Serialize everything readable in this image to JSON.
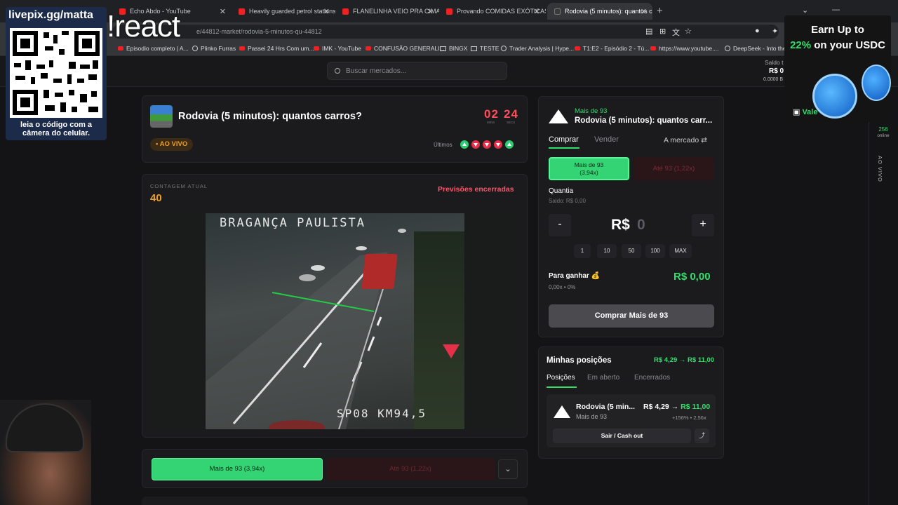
{
  "browser": {
    "tabs": [
      {
        "label": "Echo Abdo - YouTube",
        "active": false
      },
      {
        "label": "Heavily guarded petrol stations",
        "active": false
      },
      {
        "label": "FLANELINHA VEIO PRA CIMA, D",
        "active": false
      },
      {
        "label": "Provando COMIDAS EXÓTICAS",
        "active": false
      },
      {
        "label": "Rodovia (5 minutos): quantos c",
        "active": true
      }
    ],
    "url": "e/44812-market/rodovia-5-minutos-qu-44812",
    "bookmarks": [
      {
        "label": "Episodio completo | A...",
        "icon": "youtube-icon"
      },
      {
        "label": "Plinko Furras",
        "icon": "globe-icon"
      },
      {
        "label": "Passei 24 Hrs Com um...",
        "icon": "youtube-icon"
      },
      {
        "label": "IMK - YouTube",
        "icon": "youtube-icon"
      },
      {
        "label": "CONFUSÃO GENERALI...",
        "icon": "youtube-icon"
      },
      {
        "label": "BINGX",
        "icon": "folder-icon"
      },
      {
        "label": "TESTE",
        "icon": "folder-icon"
      },
      {
        "label": "Trader Analysis | Hype...",
        "icon": "globe-icon"
      },
      {
        "label": "T1:E2 - Episódio 2 - Tú...",
        "icon": "youtube-icon"
      },
      {
        "label": "https://www.youtube....",
        "icon": "youtube-icon"
      },
      {
        "label": "DeepSeek - Into the",
        "icon": "globe-icon"
      }
    ]
  },
  "header": {
    "search_placeholder": "Buscar mercados...",
    "balance_label": "Saldo t",
    "balance_value": "R$ 0",
    "balance_sub": "0.0000 B"
  },
  "overlay": {
    "handle": "livepix.gg/matta",
    "qr_caption": "leia o código com a câmera do celular.",
    "react": "!react",
    "ad_line1": "Earn Up to",
    "ad_highlight": "22%",
    "ad_line2": " on your USDC",
    "ad_vale": "Vale",
    "online_count": "256",
    "online_label": "online",
    "live_vertical": "AO VIVO"
  },
  "market": {
    "title": "Rodovia (5 minutos): quantos carros?",
    "timer_min": "02",
    "timer_sec": "24",
    "timer_min_label": "MINS",
    "timer_sec_label": "SECS",
    "live_badge": "• AO VIVO",
    "history_label": "Últimos",
    "history": [
      "up",
      "down",
      "down",
      "down",
      "up"
    ],
    "count_label": "CONTAGEM ATUAL",
    "count_value": "40",
    "predictions_status": "Previsões encerradas",
    "camera_top_text": "BRAGANÇA PAULISTA",
    "camera_bottom_text": "SP08 KM94,5",
    "btn_over": "Mais de 93 (3,94x)",
    "btn_under": "Até 93 (1,22x)",
    "expand_icon": "chevron-down-icon"
  },
  "order": {
    "side_label": "Mais de 93",
    "title": "Rodovia (5 minutos): quantos carr...",
    "tab_buy": "Comprar",
    "tab_sell": "Vender",
    "order_type": "A mercado ⇄",
    "btn_over_line1": "Mais de 93",
    "btn_over_line2": "(3,94x)",
    "btn_under": "Até 93 (1,22x)",
    "quantity_label": "Quantia",
    "saldo": "Saldo: R$ 0,00",
    "minus": "-",
    "plus": "+",
    "amount_prefix": "R$",
    "amount_value": "0",
    "quick_amounts": [
      "1",
      "10",
      "50",
      "100",
      "MAX"
    ],
    "to_win_label": "Para ganhar 💰",
    "to_win_sub": "0,00x • 0%",
    "to_win_value": "R$ 0,00",
    "submit": "Comprar Mais de 93"
  },
  "positions": {
    "title": "Minhas posições",
    "summary": "R$ 4,29 → R$ 11,00",
    "tabs": [
      "Posições",
      "Em aberto",
      "Encerrados"
    ],
    "item": {
      "name": "Rodovia (5 min...",
      "side": "Mais de 93",
      "price_from": "R$ 4,29 →",
      "price_to": "R$ 11,00",
      "stats": "+156% • 2,56x",
      "cashout": "Sair / Cash out"
    }
  },
  "colors": {
    "accent_green": "#2ee06a",
    "accent_red": "#ff4d5a",
    "live_orange": "#f0a020"
  }
}
